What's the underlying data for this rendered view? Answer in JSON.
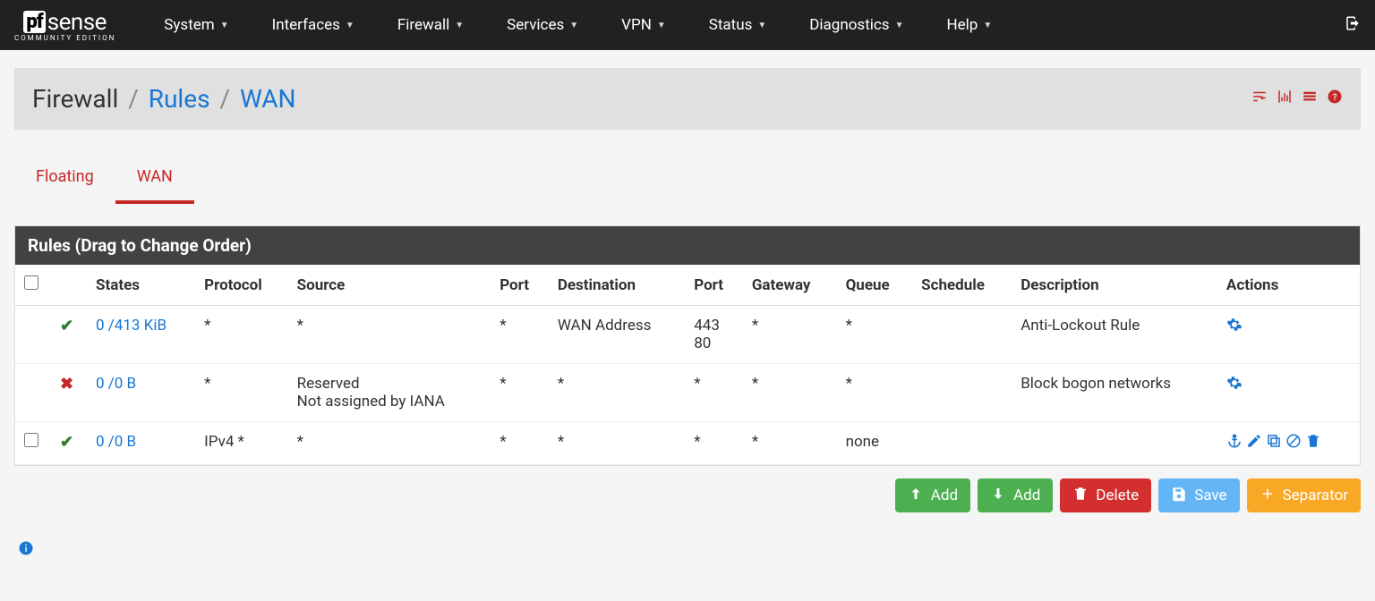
{
  "logo": {
    "box": "pf",
    "text": "sense",
    "sub": "COMMUNITY EDITION"
  },
  "nav": [
    "System",
    "Interfaces",
    "Firewall",
    "Services",
    "VPN",
    "Status",
    "Diagnostics",
    "Help"
  ],
  "breadcrumb": {
    "a": "Firewall",
    "b": "Rules",
    "c": "WAN"
  },
  "tabs": [
    {
      "label": "Floating",
      "active": false
    },
    {
      "label": "WAN",
      "active": true
    }
  ],
  "panel_title": "Rules (Drag to Change Order)",
  "columns": [
    "",
    "",
    "States",
    "Protocol",
    "Source",
    "Port",
    "Destination",
    "Port",
    "Gateway",
    "Queue",
    "Schedule",
    "Description",
    "Actions"
  ],
  "rows": [
    {
      "selectable": false,
      "type": "pass",
      "states": "0 /413 KiB",
      "protocol": "*",
      "source": "*",
      "sport": "*",
      "dest": "WAN Address",
      "dport": "443\n80",
      "gateway": "*",
      "queue": "*",
      "schedule": "",
      "desc": "Anti-Lockout Rule",
      "actions": "cog"
    },
    {
      "selectable": false,
      "type": "block",
      "states": "0 /0 B",
      "protocol": "*",
      "source": "Reserved\nNot assigned by IANA",
      "sport": "*",
      "dest": "*",
      "dport": "*",
      "gateway": "*",
      "queue": "*",
      "schedule": "",
      "desc": "Block bogon networks",
      "actions": "cog"
    },
    {
      "selectable": true,
      "type": "pass",
      "states": "0 /0 B",
      "protocol": "IPv4 *",
      "source": "*",
      "sport": "*",
      "dest": "*",
      "dport": "*",
      "gateway": "*",
      "queue": "none",
      "schedule": "",
      "desc": "",
      "actions": "full"
    }
  ],
  "buttons": {
    "add1": "Add",
    "add2": "Add",
    "delete": "Delete",
    "save": "Save",
    "separator": "Separator"
  }
}
